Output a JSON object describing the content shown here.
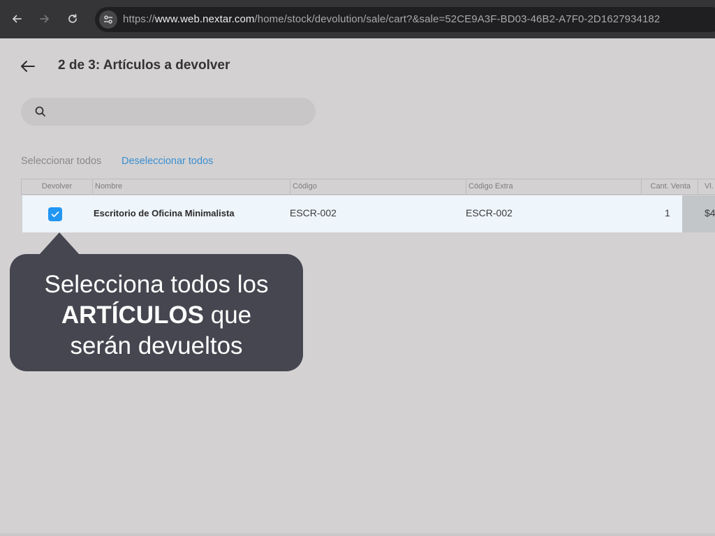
{
  "browser": {
    "url_prefix": "https://",
    "url_host": "www.web.nextar.com",
    "url_path": "/home/stock/devolution/sale/cart?&sale=52CE9A3F-BD03-46B2-A7F0-2D1627934182",
    "icons": [
      "back-arrow-icon",
      "forward-arrow-icon",
      "reload-icon",
      "site-settings-icon"
    ]
  },
  "page": {
    "title": "2 de 3: Artículos a devolver",
    "search_placeholder": ""
  },
  "selection": {
    "select_all": "Seleccionar todos",
    "deselect_all": "Deseleccionar todos"
  },
  "table": {
    "headers": [
      "Devolver",
      "Nombre",
      "Código",
      "Código Extra",
      "Cant. Venta",
      "Vl."
    ],
    "rows": [
      {
        "checked": true,
        "nombre": "Escritorio de Oficina Minimalista",
        "codigo": "ESCR-002",
        "codigo_extra": "ESCR-002",
        "cant_venta": "1",
        "valor": "$4"
      }
    ]
  },
  "tooltip": {
    "line1": "Selecciona todos los",
    "bold": "ARTÍCULOS",
    "line2_rest": " que",
    "line3": "serán devueltos"
  },
  "colors": {
    "accent": "#2196f3",
    "link": "#3a8fd0",
    "tooltip_bg": "#464650"
  }
}
